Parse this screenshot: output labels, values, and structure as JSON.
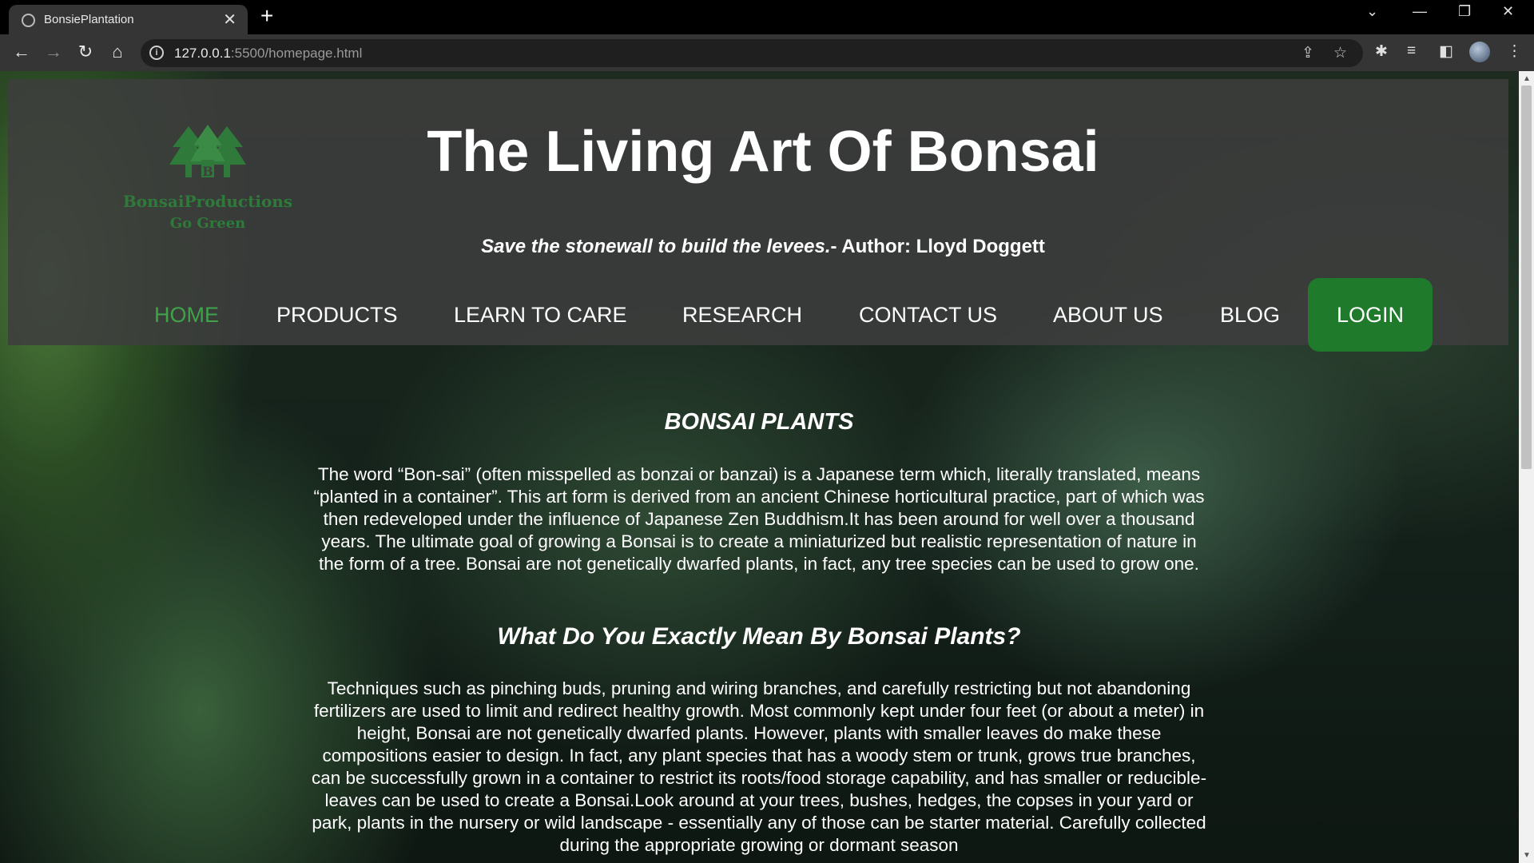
{
  "browser": {
    "tab_title": "BonsiePlantation",
    "url_host": "127.0.0.1",
    "url_rest": ":5500/homepage.html",
    "icons": [
      "back-icon",
      "forward-icon",
      "reload-icon",
      "home-icon",
      "share-icon",
      "star-icon",
      "extensions-icon",
      "media-icon",
      "sidepanel-icon",
      "menu-icon"
    ]
  },
  "header": {
    "logo_name": "BonsaiProductions",
    "logo_tagline": "Go Green",
    "logo_letter": "B",
    "title": "The Living Art Of Bonsai",
    "quote": "Save the stonewall to build the levees.",
    "quote_author": "- Author: Lloyd Doggett"
  },
  "nav": {
    "items": [
      "HOME",
      "PRODUCTS",
      "LEARN TO CARE",
      "RESEARCH",
      "CONTACT US",
      "ABOUT US",
      "BLOG"
    ],
    "active": "HOME",
    "login": "LOGIN"
  },
  "content": {
    "heading1": "BONSAI PLANTS",
    "paragraph1": "The word “Bon-sai” (often misspelled as bonzai or banzai) is a Japanese term which, literally translated, means “planted in a container”. This art form is derived from an ancient Chinese horticultural practice, part of which was then redeveloped under the influence of Japanese Zen Buddhism.It has been around for well over a thousand years. The ultimate goal of growing a Bonsai is to create a miniaturized but realistic representation of nature in the form of a tree. Bonsai are not genetically dwarfed plants, in fact, any tree species can be used to grow one.",
    "heading2": "What Do You Exactly Mean By Bonsai Plants?",
    "paragraph2": "Techniques such as pinching buds, pruning and wiring branches, and carefully restricting but not abandoning fertilizers are used to limit and redirect healthy growth. Most commonly kept under four feet (or about a meter) in height, Bonsai are not genetically dwarfed plants. However, plants with smaller leaves do make these compositions easier to design. In fact, any plant species that has a woody stem or trunk, grows true branches, can be successfully grown in a container to restrict its roots/food storage capability, and has smaller or reducible-leaves can be used to create a Bonsai.Look around at your trees, bushes, hedges, the copses in your yard or park, plants in the nursery or wild landscape - essentially any of those can be starter material. Carefully collected during the appropriate growing or dormant season"
  },
  "colors": {
    "accent": "#1f7a2c",
    "active_nav": "#3fa34a",
    "logo": "#2f7a3a"
  }
}
